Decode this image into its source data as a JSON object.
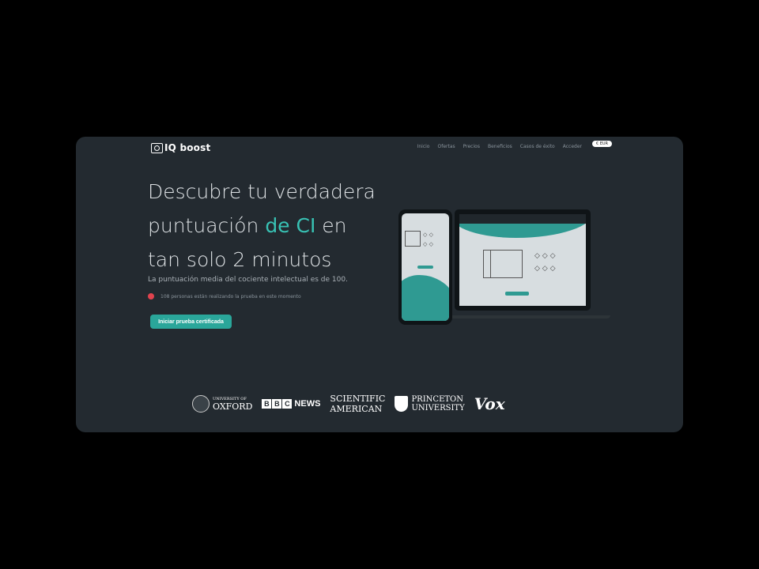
{
  "header": {
    "logo_text": "IQ boost",
    "nav": [
      "Inicio",
      "Ofertas",
      "Precios",
      "Beneficios",
      "Casos de éxito",
      "Acceder"
    ],
    "currency": "€ EUR"
  },
  "hero": {
    "headline_part1": "Descubre tu verdadera puntuación ",
    "headline_accent": "de CI",
    "headline_part2": " en tan solo 2 minutos",
    "subtitle": "La puntuación media del cociente intelectual es de 100.",
    "live_status": "108 personas están realizando la prueba en este momento",
    "cta_label": "Iniciar prueba certificada"
  },
  "logos": {
    "oxford_small": "UNIVERSITY OF",
    "oxford_large": "OXFORD",
    "bbc_letters": [
      "B",
      "B",
      "C"
    ],
    "bbc_news": "NEWS",
    "sciam_line1": "SCIENTIFIC",
    "sciam_line2": "AMERICAN",
    "princeton_line1": "PRINCETON",
    "princeton_line2": "UNIVERSITY",
    "vox": "Vox"
  },
  "colors": {
    "background": "#000000",
    "card": "#232a30",
    "accent": "#38c2b4",
    "button": "#2aa69a",
    "live_dot": "#e0434e"
  },
  "icons": [
    "logo-icon",
    "live-dot-icon",
    "oxford-crest-icon",
    "princeton-shield-icon"
  ]
}
